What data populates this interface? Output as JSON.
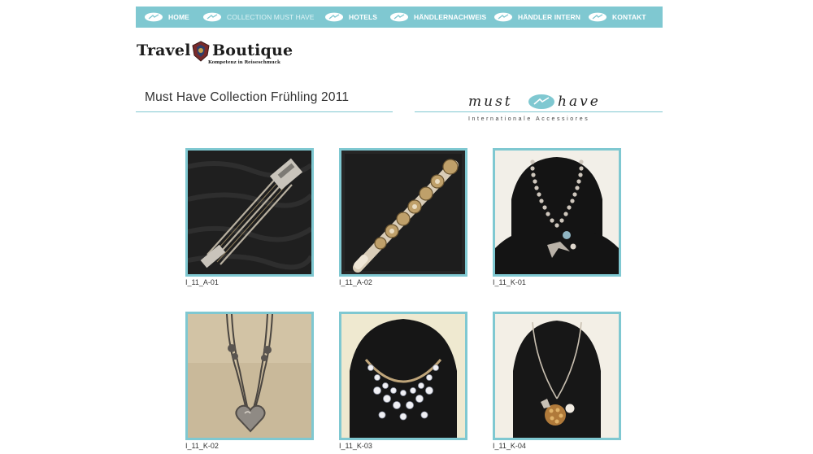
{
  "nav": {
    "items": [
      {
        "label": "HOME",
        "active": false
      },
      {
        "label": "COLLECTION MUST HAVE",
        "active": true
      },
      {
        "label": "HOTELS",
        "active": false
      },
      {
        "label": "HÄNDLERNACHWEIS",
        "active": false
      },
      {
        "label": "HÄNDLER INTERN",
        "active": false
      },
      {
        "label": "KONTAKT",
        "active": false
      }
    ],
    "icon": "fish-icon"
  },
  "logo": {
    "word_left": "Travel",
    "word_right": "Boutique",
    "tagline": "Kompetenz in Reiseschmuck",
    "emblem": "crest-icon"
  },
  "page_title": "Must Have Collection Frühling 2011",
  "brand": {
    "word_left": "must",
    "word_right": "have",
    "tagline": "Internationale Accessiores",
    "emblem": "fish-icon"
  },
  "gallery": [
    {
      "caption": "I_11_A-01",
      "kind": "bracelet-chains"
    },
    {
      "caption": "I_11_A-02",
      "kind": "bracelet-studs"
    },
    {
      "caption": "I_11_K-01",
      "kind": "necklace-bird"
    },
    {
      "caption": "I_11_K-02",
      "kind": "necklace-heart"
    },
    {
      "caption": "I_11_K-03",
      "kind": "necklace-crystals"
    },
    {
      "caption": "I_11_K-04",
      "kind": "necklace-ball"
    }
  ],
  "colors": {
    "accent": "#7fc8d1",
    "nav_text": "#ffffff",
    "text": "#333333"
  }
}
